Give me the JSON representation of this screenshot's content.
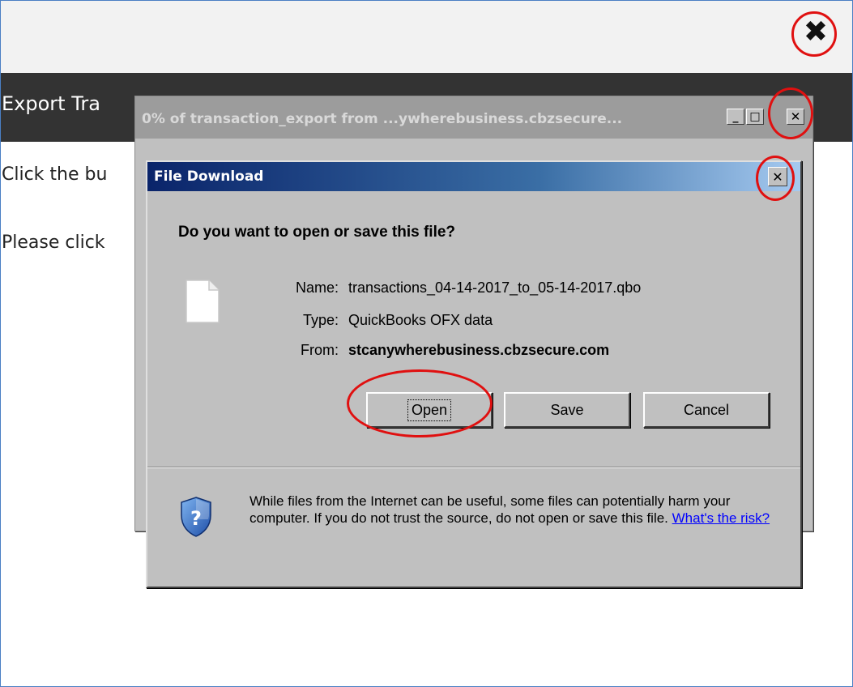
{
  "page": {
    "title": "Export Tra",
    "line1": "Click the bu",
    "line2": "Please click",
    "close_glyph": "✖"
  },
  "progress_window": {
    "title": "0% of transaction_export from ...ywherebusiness.cbzsecure...",
    "minimize": "_",
    "maximize": "□",
    "close": "✕"
  },
  "download_dialog": {
    "title": "File Download",
    "close": "✕",
    "question": "Do you want to open or save this file?",
    "name_label": "Name:",
    "name_value": "transactions_04-14-2017_to_05-14-2017.qbo",
    "type_label": "Type:",
    "type_value": "QuickBooks OFX data",
    "from_label": "From:",
    "from_value": "stcanywherebusiness.cbzsecure.com",
    "buttons": {
      "open": "Open",
      "save": "Save",
      "cancel": "Cancel"
    },
    "warning_text": "While files from the Internet can be useful, some files can potentially harm your computer. If you do not trust the source, do not open or save this file.",
    "risk_link": "What's the risk?"
  },
  "colors": {
    "annotation": "#e01010",
    "titlebar_active": "#0a246a",
    "header_dark": "#333333"
  }
}
